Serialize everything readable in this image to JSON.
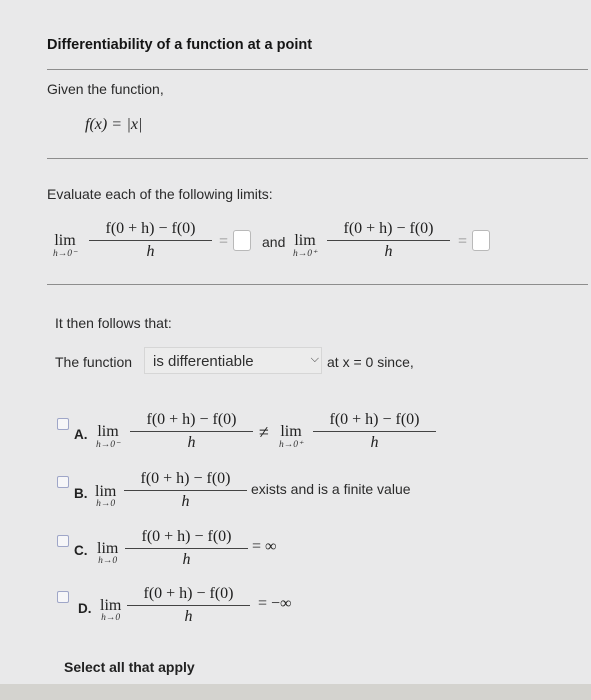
{
  "header": {
    "title": "Differentiability of a function at a point"
  },
  "given": {
    "intro": "Given the function,",
    "function_lhs": "f(x) =",
    "function_rhs": "|x|"
  },
  "evaluate": {
    "prompt": "Evaluate each of the following limits:",
    "lim": "lim",
    "left_sub": "h→0⁻",
    "right_sub": "h→0⁺",
    "numerator": "f(0 + h) − f(0)",
    "denominator": "h",
    "equals": "=",
    "connector": "and"
  },
  "follows": {
    "text": "It then follows that:"
  },
  "statement": {
    "prefix": "The function",
    "dropdown_value": "is differentiable",
    "suffix": "at x = 0 since,"
  },
  "options": [
    {
      "label": "A.",
      "lim": "lim",
      "sub": "h→0⁻",
      "numerator": "f(0 + h) − f(0)",
      "denominator": "h",
      "relation": "≠",
      "lim2": "lim",
      "sub2": "h→0⁺",
      "numerator2": "f(0 + h) − f(0)",
      "denominator2": "h"
    },
    {
      "label": "B.",
      "lim": "lim",
      "sub": "h→0",
      "numerator": "f(0 + h) − f(0)",
      "denominator": "h",
      "tail": "exists and is a finite value"
    },
    {
      "label": "C.",
      "lim": "lim",
      "sub": "h→0",
      "numerator": "f(0 + h) − f(0)",
      "denominator": "h",
      "tail": "= ∞"
    },
    {
      "label": "D.",
      "lim": "lim",
      "sub": "h→0",
      "numerator": "f(0 + h) − f(0)",
      "denominator": "h",
      "tail": "= −∞"
    }
  ],
  "footer": {
    "instruction": "Select all that apply"
  },
  "colors": {
    "background": "#e9e9ea",
    "rule": "#8d8d8d",
    "checkbox_border": "#9fa6c8"
  },
  "icons": {
    "dropdown": "chevron-down-icon",
    "checkbox": "checkbox-icon"
  }
}
